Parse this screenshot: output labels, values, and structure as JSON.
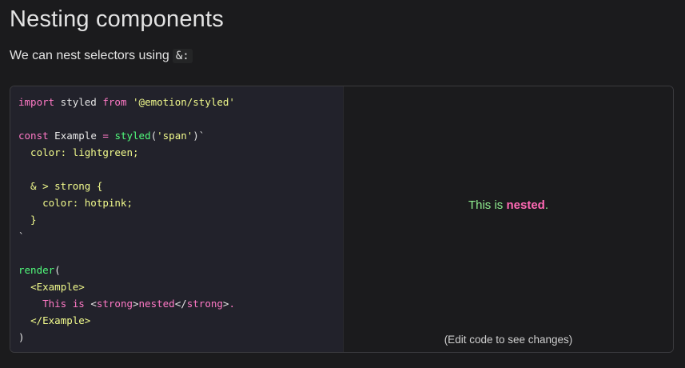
{
  "heading": "Nesting components",
  "intro": {
    "text": "We can nest selectors using",
    "code": "&:"
  },
  "editor": {
    "lines": [
      [
        {
          "c": "k",
          "t": "import"
        },
        {
          "c": "p",
          "t": " styled "
        },
        {
          "c": "k",
          "t": "from"
        },
        {
          "c": "p",
          "t": " "
        },
        {
          "c": "s",
          "t": "'@emotion/styled'"
        }
      ],
      [],
      [
        {
          "c": "k",
          "t": "const"
        },
        {
          "c": "p",
          "t": " Example "
        },
        {
          "c": "k",
          "t": "="
        },
        {
          "c": "p",
          "t": " "
        },
        {
          "c": "f",
          "t": "styled"
        },
        {
          "c": "p",
          "t": "("
        },
        {
          "c": "s",
          "t": "'span'"
        },
        {
          "c": "p",
          "t": ")`"
        }
      ],
      [
        {
          "c": "s",
          "t": "  color: lightgreen;"
        }
      ],
      [],
      [
        {
          "c": "s",
          "t": "  & > strong {"
        }
      ],
      [
        {
          "c": "s",
          "t": "    color: hotpink;"
        }
      ],
      [
        {
          "c": "s",
          "t": "  }"
        }
      ],
      [
        {
          "c": "p",
          "t": "`"
        }
      ],
      [],
      [
        {
          "c": "f",
          "t": "render"
        },
        {
          "c": "p",
          "t": "("
        }
      ],
      [
        {
          "c": "p",
          "t": "  "
        },
        {
          "c": "s",
          "t": "<Example>"
        }
      ],
      [
        {
          "c": "txt",
          "t": "    This is "
        },
        {
          "c": "p",
          "t": "<"
        },
        {
          "c": "t",
          "t": "strong"
        },
        {
          "c": "p",
          "t": ">"
        },
        {
          "c": "txt",
          "t": "nested"
        },
        {
          "c": "p",
          "t": "</"
        },
        {
          "c": "t",
          "t": "strong"
        },
        {
          "c": "p",
          "t": ">"
        },
        {
          "c": "txt",
          "t": "."
        }
      ],
      [
        {
          "c": "p",
          "t": "  "
        },
        {
          "c": "s",
          "t": "</Example>"
        }
      ],
      [
        {
          "c": "p",
          "t": ")"
        }
      ]
    ]
  },
  "preview": {
    "text_before": "This is ",
    "strong_text": "nested",
    "text_after": ".",
    "hint": "(Edit code to see changes)"
  }
}
